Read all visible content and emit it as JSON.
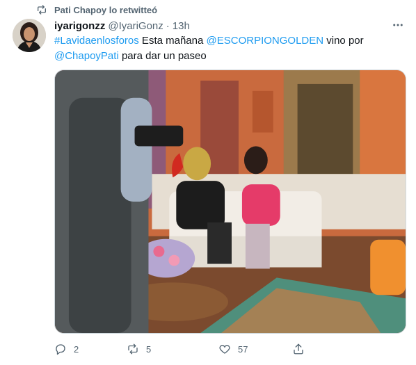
{
  "retweet_header": {
    "icon": "retweet-icon",
    "label": "Pati Chapoy lo retwitteó"
  },
  "tweet": {
    "name": "iyarigonzz",
    "handle": "@IyariGonz",
    "separator": "·",
    "time": "13h",
    "text": {
      "hashtag": "#Lavidaenlosforos",
      "part1": " Esta mañana ",
      "mention1": "@ESCORPIONGOLDEN",
      "part2": " vino por",
      "mention2": "@ChapoyPati",
      "part3": " para dar un paseo"
    }
  },
  "actions": {
    "reply_count": "2",
    "retweet_count": "5",
    "like_count": "57"
  },
  "colors": {
    "link": "#1d9bf0",
    "muted": "#536471",
    "text": "#0f1419"
  }
}
